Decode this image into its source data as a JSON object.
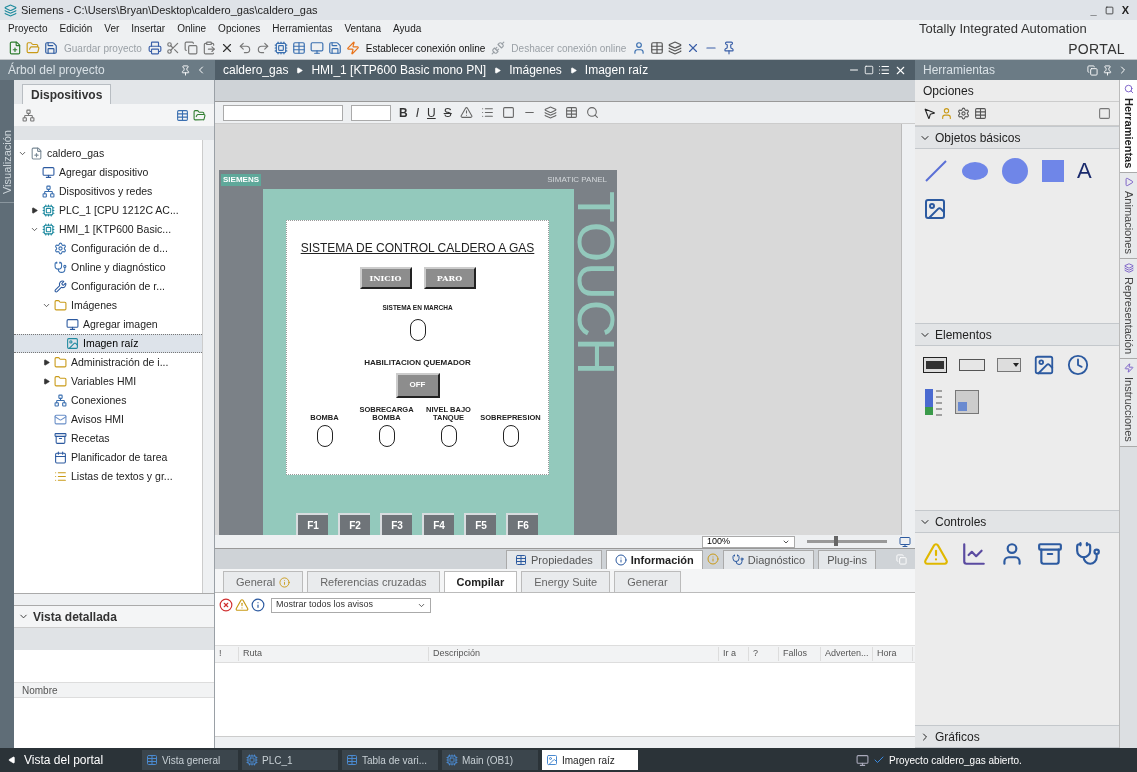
{
  "window": {
    "title": "Siemens - C:\\Users\\Bryan\\Desktop\\caldero_gas\\caldero_gas",
    "controls": [
      "_",
      "X"
    ]
  },
  "menu": [
    "Proyecto",
    "Edición",
    "Ver",
    "Insertar",
    "Online",
    "Opciones",
    "Herramientas",
    "Ventana",
    "Ayuda"
  ],
  "toolbar": [
    {
      "label": "Guardar proyecto",
      "disabled": true
    },
    {
      "label": "Establecer conexión online",
      "disabled": false
    },
    {
      "label": "Deshacer conexión online",
      "disabled": true
    }
  ],
  "brand": {
    "line_1": "Totally Integrated Automation",
    "line_2": "PORTAL"
  },
  "project_tree": {
    "title": "Árbol del proyecto",
    "side_tab": "Visualización",
    "tab": "Dispositivos",
    "items": [
      {
        "label": "caldero_gas",
        "kind": "project",
        "expanded": true,
        "selected": false,
        "children": [
          {
            "label": "Agregar dispositivo",
            "kind": "add",
            "selected": false
          },
          {
            "label": "Dispositivos y redes",
            "kind": "network",
            "selected": false
          },
          {
            "label": "PLC_1 [CPU 1212C AC...",
            "kind": "device",
            "expanded": false,
            "selected": false
          },
          {
            "label": "HMI_1 [KTP600 Basic...",
            "kind": "device",
            "expanded": true,
            "selected": false,
            "children": [
              {
                "label": "Configuración de d...",
                "kind": "config",
                "selected": false
              },
              {
                "label": "Online y diagnóstico",
                "kind": "diagnostics",
                "selected": false
              },
              {
                "label": "Configuración de r...",
                "kind": "tool",
                "selected": false
              },
              {
                "label": "Imágenes",
                "kind": "folder",
                "expanded": true,
                "selected": false,
                "children": [
                  {
                    "label": "Agregar imagen",
                    "kind": "add",
                    "selected": false
                  },
                  {
                    "label": "Imagen raíz",
                    "kind": "screen",
                    "selected": true
                  }
                ]
              },
              {
                "label": "Administración de i...",
                "kind": "folder",
                "expanded": false,
                "selected": false
              },
              {
                "label": "Variables HMI",
                "kind": "folder",
                "expanded": false,
                "selected": false
              },
              {
                "label": "Conexiones",
                "kind": "connection",
                "selected": false
              },
              {
                "label": "Avisos HMI",
                "kind": "alarm",
                "selected": false
              },
              {
                "label": "Recetas",
                "kind": "recipe",
                "selected": false
              },
              {
                "label": "Planificador de tarea",
                "kind": "scheduler",
                "selected": false
              },
              {
                "label": "Listas de textos y gr...",
                "kind": "textlist",
                "selected": false
              }
            ]
          }
        ]
      }
    ]
  },
  "detail_view": {
    "title": "Vista detallada",
    "expanded": true,
    "columns": [
      "Nombre"
    ]
  },
  "editor": {
    "breadcrumb": [
      "caldero_gas",
      "HMI_1 [KTP600 Basic mono PN]",
      "Imágenes",
      "Imagen raíz"
    ],
    "format_buttons": [
      "B",
      "I",
      "U",
      "S"
    ],
    "device": {
      "brand": "SIEMENS",
      "model": "SIMATIC PANEL",
      "side_label": "TOUCH",
      "screen": {
        "title": "SISTEMA DE CONTROL CALDERO A GAS",
        "buttons": [
          "INICIO",
          "PARO"
        ],
        "status_label": "SISTEMA EN MARCHA",
        "burner_label": "HABILITACION QUEMADOR",
        "burner_button": "OFF",
        "indicators": [
          "BOMBA",
          "SOBRECARGA BOMBA",
          "NIVEL BAJO TANQUE",
          "SOBREPRESION"
        ]
      },
      "function_keys": [
        "F1",
        "F2",
        "F3",
        "F4",
        "F5",
        "F6"
      ]
    },
    "zoom": {
      "value": "100%",
      "level": 0.35
    }
  },
  "inspector": {
    "tabs": [
      {
        "label": "Propiedades",
        "selected": false
      },
      {
        "label": "Información",
        "selected": true
      },
      {
        "label": "Diagnóstico",
        "selected": false
      },
      {
        "label": "Plug-ins",
        "selected": false
      }
    ],
    "subtabs": [
      {
        "label": "General",
        "selected": false
      },
      {
        "label": "Referencias cruzadas",
        "selected": false
      },
      {
        "label": "Compilar",
        "selected": true
      },
      {
        "label": "Energy Suite",
        "selected": false
      },
      {
        "label": "Generar",
        "selected": false
      }
    ],
    "filter": "Mostrar todos los avisos",
    "columns": [
      "!",
      "Ruta",
      "Descripción",
      "Ir a",
      "?",
      "Fallos",
      "Adverten...",
      "Hora"
    ]
  },
  "tools": {
    "title": "Herramientas",
    "options": "Opciones",
    "sections": [
      {
        "title": "Objetos básicos",
        "kind": "basic",
        "expanded": true,
        "glyph": "A"
      },
      {
        "title": "Elementos",
        "kind": "elements",
        "expanded": true
      },
      {
        "title": "Controles",
        "kind": "controls",
        "expanded": true
      },
      {
        "title": "Gráficos",
        "kind": "graphics",
        "expanded": false
      }
    ],
    "side_tabs": [
      {
        "label": "Herramientas",
        "selected": true
      },
      {
        "label": "Animaciones",
        "selected": false
      },
      {
        "label": "Representación",
        "selected": false
      },
      {
        "label": "Instrucciones",
        "selected": false
      }
    ]
  },
  "taskbar": {
    "portal": "Vista del portal",
    "tasks": [
      {
        "label": "Vista general",
        "selected": false
      },
      {
        "label": "PLC_1",
        "selected": false
      },
      {
        "label": "Tabla de vari...",
        "selected": false
      },
      {
        "label": "Main (OB1)",
        "selected": false
      },
      {
        "label": "Imagen raíz",
        "selected": true
      }
    ],
    "status": "Proyecto caldero_gas abierto."
  }
}
